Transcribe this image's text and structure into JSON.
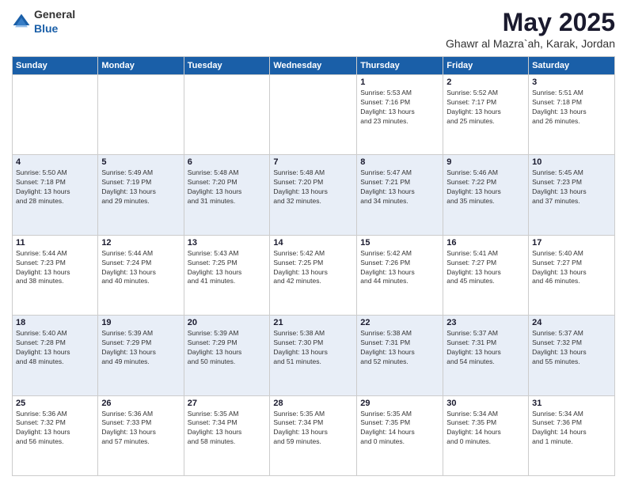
{
  "header": {
    "logo_general": "General",
    "logo_blue": "Blue",
    "month_year": "May 2025",
    "location": "Ghawr al Mazra`ah, Karak, Jordan"
  },
  "weekdays": [
    "Sunday",
    "Monday",
    "Tuesday",
    "Wednesday",
    "Thursday",
    "Friday",
    "Saturday"
  ],
  "rows": [
    [
      {
        "day": "",
        "info": ""
      },
      {
        "day": "",
        "info": ""
      },
      {
        "day": "",
        "info": ""
      },
      {
        "day": "",
        "info": ""
      },
      {
        "day": "1",
        "info": "Sunrise: 5:53 AM\nSunset: 7:16 PM\nDaylight: 13 hours\nand 23 minutes."
      },
      {
        "day": "2",
        "info": "Sunrise: 5:52 AM\nSunset: 7:17 PM\nDaylight: 13 hours\nand 25 minutes."
      },
      {
        "day": "3",
        "info": "Sunrise: 5:51 AM\nSunset: 7:18 PM\nDaylight: 13 hours\nand 26 minutes."
      }
    ],
    [
      {
        "day": "4",
        "info": "Sunrise: 5:50 AM\nSunset: 7:18 PM\nDaylight: 13 hours\nand 28 minutes."
      },
      {
        "day": "5",
        "info": "Sunrise: 5:49 AM\nSunset: 7:19 PM\nDaylight: 13 hours\nand 29 minutes."
      },
      {
        "day": "6",
        "info": "Sunrise: 5:48 AM\nSunset: 7:20 PM\nDaylight: 13 hours\nand 31 minutes."
      },
      {
        "day": "7",
        "info": "Sunrise: 5:48 AM\nSunset: 7:20 PM\nDaylight: 13 hours\nand 32 minutes."
      },
      {
        "day": "8",
        "info": "Sunrise: 5:47 AM\nSunset: 7:21 PM\nDaylight: 13 hours\nand 34 minutes."
      },
      {
        "day": "9",
        "info": "Sunrise: 5:46 AM\nSunset: 7:22 PM\nDaylight: 13 hours\nand 35 minutes."
      },
      {
        "day": "10",
        "info": "Sunrise: 5:45 AM\nSunset: 7:23 PM\nDaylight: 13 hours\nand 37 minutes."
      }
    ],
    [
      {
        "day": "11",
        "info": "Sunrise: 5:44 AM\nSunset: 7:23 PM\nDaylight: 13 hours\nand 38 minutes."
      },
      {
        "day": "12",
        "info": "Sunrise: 5:44 AM\nSunset: 7:24 PM\nDaylight: 13 hours\nand 40 minutes."
      },
      {
        "day": "13",
        "info": "Sunrise: 5:43 AM\nSunset: 7:25 PM\nDaylight: 13 hours\nand 41 minutes."
      },
      {
        "day": "14",
        "info": "Sunrise: 5:42 AM\nSunset: 7:25 PM\nDaylight: 13 hours\nand 42 minutes."
      },
      {
        "day": "15",
        "info": "Sunrise: 5:42 AM\nSunset: 7:26 PM\nDaylight: 13 hours\nand 44 minutes."
      },
      {
        "day": "16",
        "info": "Sunrise: 5:41 AM\nSunset: 7:27 PM\nDaylight: 13 hours\nand 45 minutes."
      },
      {
        "day": "17",
        "info": "Sunrise: 5:40 AM\nSunset: 7:27 PM\nDaylight: 13 hours\nand 46 minutes."
      }
    ],
    [
      {
        "day": "18",
        "info": "Sunrise: 5:40 AM\nSunset: 7:28 PM\nDaylight: 13 hours\nand 48 minutes."
      },
      {
        "day": "19",
        "info": "Sunrise: 5:39 AM\nSunset: 7:29 PM\nDaylight: 13 hours\nand 49 minutes."
      },
      {
        "day": "20",
        "info": "Sunrise: 5:39 AM\nSunset: 7:29 PM\nDaylight: 13 hours\nand 50 minutes."
      },
      {
        "day": "21",
        "info": "Sunrise: 5:38 AM\nSunset: 7:30 PM\nDaylight: 13 hours\nand 51 minutes."
      },
      {
        "day": "22",
        "info": "Sunrise: 5:38 AM\nSunset: 7:31 PM\nDaylight: 13 hours\nand 52 minutes."
      },
      {
        "day": "23",
        "info": "Sunrise: 5:37 AM\nSunset: 7:31 PM\nDaylight: 13 hours\nand 54 minutes."
      },
      {
        "day": "24",
        "info": "Sunrise: 5:37 AM\nSunset: 7:32 PM\nDaylight: 13 hours\nand 55 minutes."
      }
    ],
    [
      {
        "day": "25",
        "info": "Sunrise: 5:36 AM\nSunset: 7:32 PM\nDaylight: 13 hours\nand 56 minutes."
      },
      {
        "day": "26",
        "info": "Sunrise: 5:36 AM\nSunset: 7:33 PM\nDaylight: 13 hours\nand 57 minutes."
      },
      {
        "day": "27",
        "info": "Sunrise: 5:35 AM\nSunset: 7:34 PM\nDaylight: 13 hours\nand 58 minutes."
      },
      {
        "day": "28",
        "info": "Sunrise: 5:35 AM\nSunset: 7:34 PM\nDaylight: 13 hours\nand 59 minutes."
      },
      {
        "day": "29",
        "info": "Sunrise: 5:35 AM\nSunset: 7:35 PM\nDaylight: 14 hours\nand 0 minutes."
      },
      {
        "day": "30",
        "info": "Sunrise: 5:34 AM\nSunset: 7:35 PM\nDaylight: 14 hours\nand 0 minutes."
      },
      {
        "day": "31",
        "info": "Sunrise: 5:34 AM\nSunset: 7:36 PM\nDaylight: 14 hours\nand 1 minute."
      }
    ]
  ]
}
